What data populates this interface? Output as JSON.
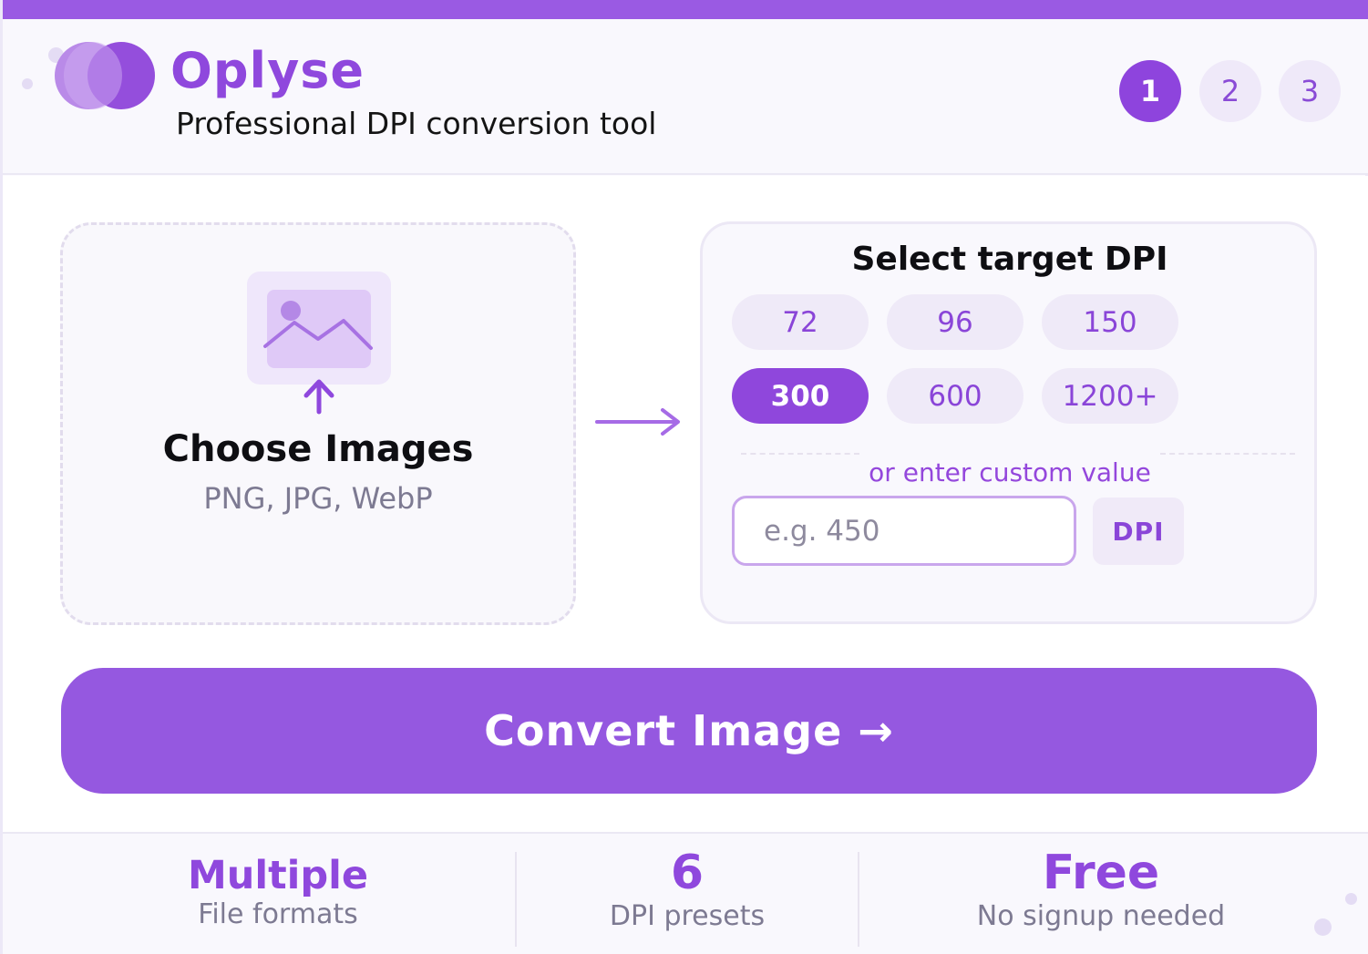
{
  "app": {
    "name": "Oplyse",
    "tagline": "Professional DPI conversion tool"
  },
  "steps": [
    "1",
    "2",
    "3"
  ],
  "active_step": "1",
  "upload": {
    "title": "Choose Images",
    "formats": "PNG, JPG, WebP"
  },
  "dpi": {
    "title": "Select target DPI",
    "presets": [
      "72",
      "96",
      "150",
      "300",
      "600",
      "1200+"
    ],
    "selected": "300",
    "custom_label": "or enter custom value",
    "custom_placeholder": "e.g. 450",
    "unit": "DPI"
  },
  "convert_label": "Convert Image →",
  "stats": [
    {
      "value": "Multiple",
      "label": "File formats"
    },
    {
      "value": "6",
      "label": "DPI presets"
    },
    {
      "value": "Free",
      "label": "No signup needed"
    }
  ],
  "colors": {
    "accent": "#8f48dd",
    "button": "#9558e0",
    "preset_bg": "#efeaf8"
  },
  "icons": {
    "upload": "image-upload-icon",
    "flow": "arrow-right-icon"
  }
}
